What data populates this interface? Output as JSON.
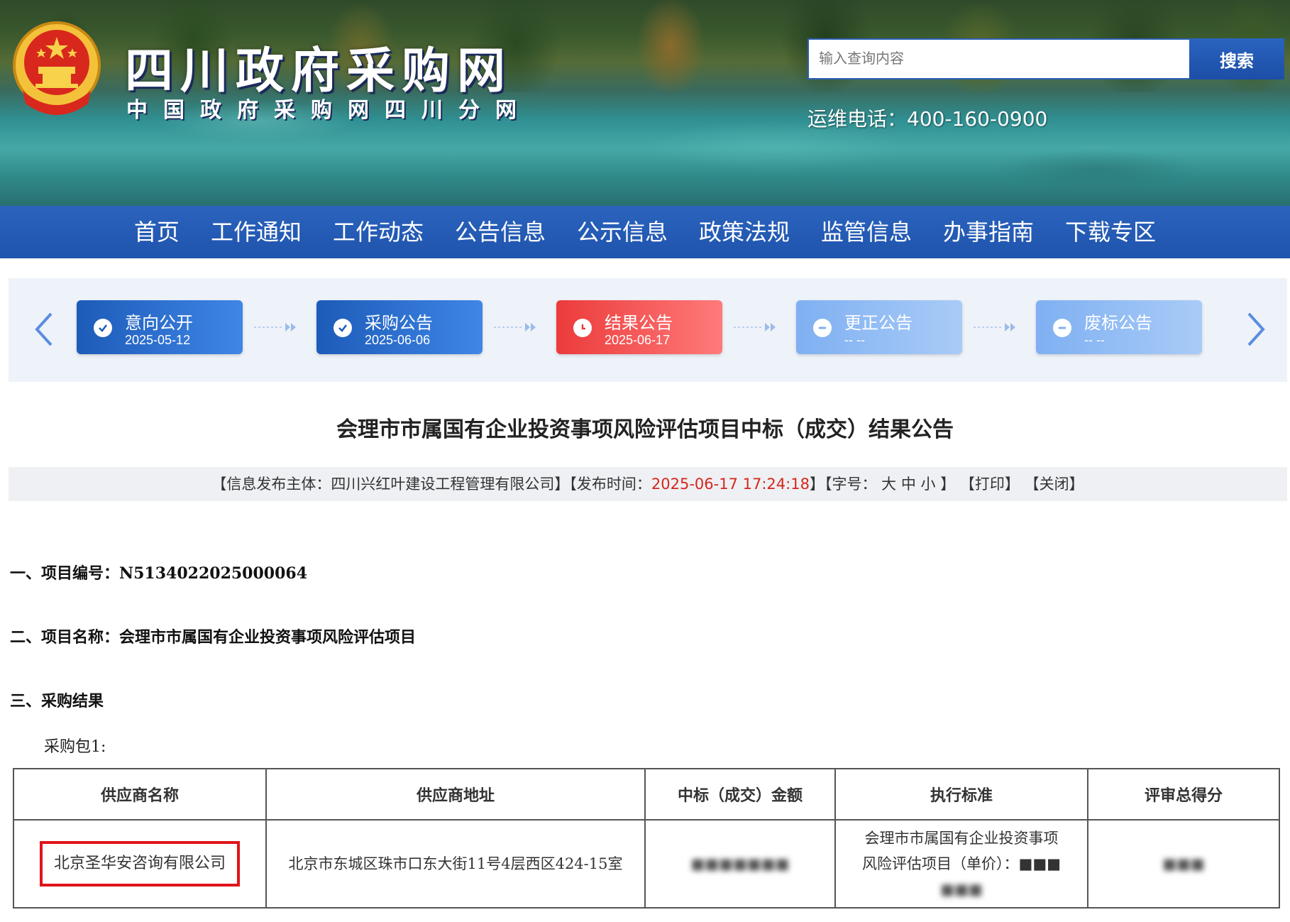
{
  "header": {
    "site_title": "四川政府采购网",
    "site_subtitle": "中国政府采购网四川分网",
    "search_placeholder": "输入查询内容",
    "search_button": "搜索",
    "hotline": "运维电话：400-160-0900"
  },
  "nav": {
    "items": [
      "首页",
      "工作通知",
      "工作动态",
      "公告信息",
      "公示信息",
      "政策法规",
      "监管信息",
      "办事指南",
      "下载专区"
    ]
  },
  "timeline": {
    "steps": [
      {
        "label": "意向公开",
        "date": "2025-05-12",
        "state": "done"
      },
      {
        "label": "采购公告",
        "date": "2025-06-06",
        "state": "done"
      },
      {
        "label": "结果公告",
        "date": "2025-06-17",
        "state": "active"
      },
      {
        "label": "更正公告",
        "date": "-- --",
        "state": "pending"
      },
      {
        "label": "废标公告",
        "date": "-- --",
        "state": "pending"
      }
    ],
    "prev_icon": "chevron-left-icon",
    "next_icon": "chevron-right-icon"
  },
  "article": {
    "title": "会理市市属国有企业投资事项风险评估项目中标（成交）结果公告",
    "meta": {
      "publisher_prefix": "【信息发布主体：",
      "publisher": "四川兴红叶建设工程管理有限公司",
      "publisher_suffix": "】",
      "time_prefix": "【发布时间：",
      "time": "2025-06-17 17:24:18",
      "time_suffix": "】",
      "font_prefix": "【字号：",
      "font_large": "大",
      "font_medium": "中",
      "font_small": "小",
      "font_suffix": "】",
      "print": "【打印】",
      "close": "【关闭】"
    },
    "section1": "一、项目编号：N5134022025000064",
    "section2": "二、项目名称：会理市市属国有企业投资事项风险评估项目",
    "section3": "三、采购结果",
    "package": "采购包1:",
    "table": {
      "headers": [
        "供应商名称",
        "供应商地址",
        "中标（成交）金额",
        "执行标准",
        "评审总得分"
      ],
      "row": {
        "supplier": "北京圣华安咨询有限公司",
        "address": "北京市东城区珠市口东大街11号4层西区424-15室",
        "amount": "■■■■■■■",
        "standard_line1": "会理市市属国有企业投资事项",
        "standard_line2": "风险评估项目（单价）：■■■",
        "standard_line3": "■■■",
        "score": "■■■"
      }
    }
  },
  "colors": {
    "nav_blue": "#1f54ad",
    "active_red": "#ec3b3b",
    "highlight_red": "#e1141a",
    "time_red": "#d7261b"
  }
}
